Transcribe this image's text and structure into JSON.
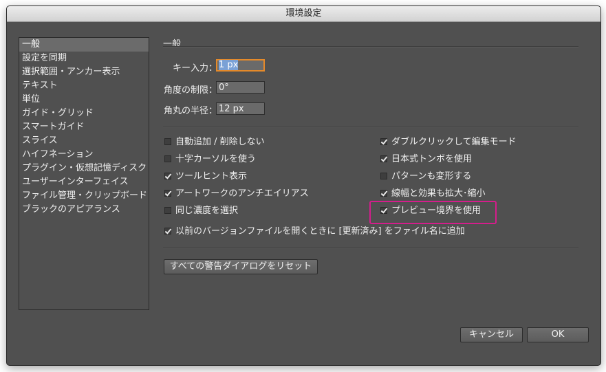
{
  "window": {
    "title": "環境設定"
  },
  "sidebar": {
    "items": [
      {
        "label": "一般"
      },
      {
        "label": "設定を同期"
      },
      {
        "label": "選択範囲・アンカー表示"
      },
      {
        "label": "テキスト"
      },
      {
        "label": "単位"
      },
      {
        "label": "ガイド・グリッド"
      },
      {
        "label": "スマートガイド"
      },
      {
        "label": "スライス"
      },
      {
        "label": "ハイフネーション"
      },
      {
        "label": "プラグイン・仮想記憶ディスク"
      },
      {
        "label": "ユーザーインターフェイス"
      },
      {
        "label": "ファイル管理・クリップボード"
      },
      {
        "label": "ブラックのアピアランス"
      }
    ],
    "selected": "一般"
  },
  "main": {
    "section_title": "一般",
    "fields": {
      "key_input": {
        "label": "キー入力：",
        "value": "1 px"
      },
      "angle": {
        "label": "角度の制限：",
        "value": "0°"
      },
      "corner_radius": {
        "label": "角丸の半径：",
        "value": "12 px"
      }
    },
    "checkboxes": {
      "auto_add_delete": {
        "label": "自動追加 / 削除しない",
        "checked": false
      },
      "crosshair_cursor": {
        "label": "十字カーソルを使う",
        "checked": false
      },
      "tooltips": {
        "label": "ツールヒント表示",
        "checked": true
      },
      "antialias": {
        "label": "アートワークのアンチエイリアス",
        "checked": true
      },
      "same_tint": {
        "label": "同じ濃度を選択",
        "checked": false
      },
      "double_click_isolate": {
        "label": "ダブルクリックして編集モード",
        "checked": true
      },
      "japanese_crop_marks": {
        "label": "日本式トンボを使用",
        "checked": true
      },
      "transform_patterns": {
        "label": "パターンも変形する",
        "checked": false
      },
      "scale_strokes": {
        "label": "線幅と効果も拡大･縮小",
        "checked": true
      },
      "preview_bounds": {
        "label": "プレビュー境界を使用",
        "checked": true
      },
      "append_updated": {
        "label": "以前のバージョンファイルを開くときに [更新済み] をファイル名に追加",
        "checked": true
      }
    },
    "reset_warnings_label": "すべての警告ダイアログをリセット"
  },
  "footer": {
    "cancel_label": "キャンセル",
    "ok_label": "OK"
  },
  "colors": {
    "highlight": "#d51d8c",
    "focus": "#e58a2a",
    "panel": "#505050"
  }
}
